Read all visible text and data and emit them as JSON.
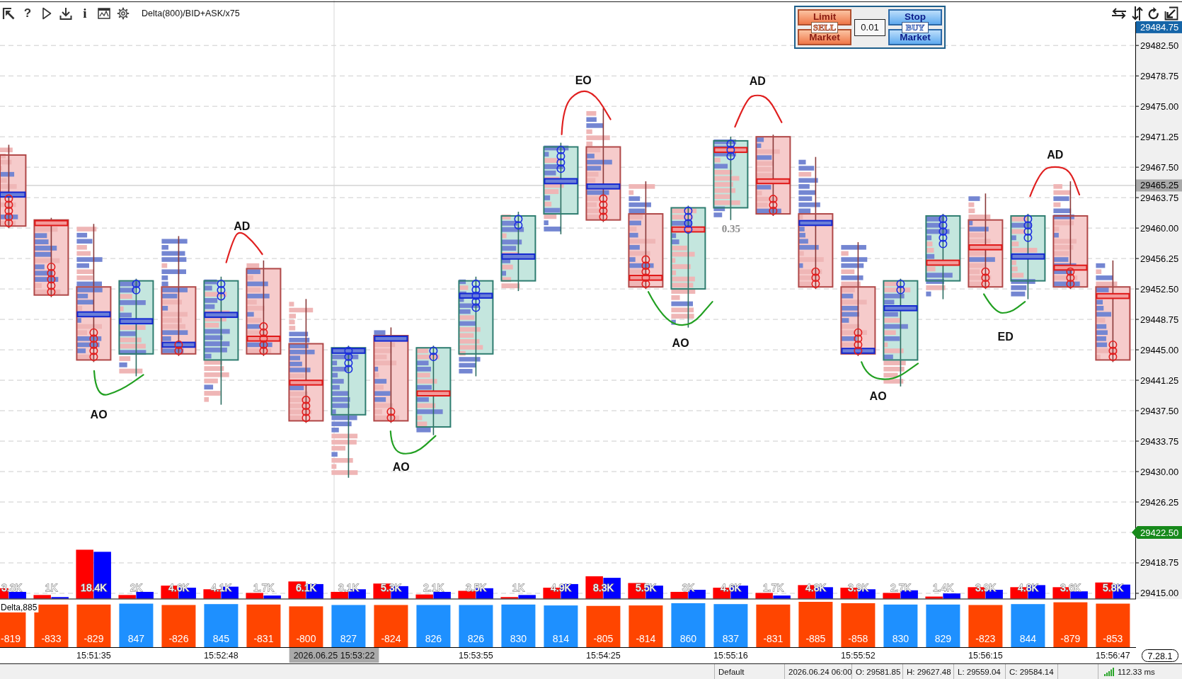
{
  "toolbar": {
    "help_glyph": "?",
    "info_glyph": "i",
    "study": "Delta(800)/BID+ASK/x75"
  },
  "order_panel": {
    "sell_buttons": [
      "Limit",
      "Market"
    ],
    "sell_tag": "SELL",
    "quantity": "0.01",
    "buy_buttons": [
      "Stop",
      "Market"
    ],
    "buy_tag": "BUY"
  },
  "chart": {
    "price_axis": {
      "labels": [
        "29482.50",
        "29478.75",
        "29475.00",
        "29471.25",
        "29467.50",
        "29463.75",
        "29460.00",
        "29456.25",
        "29452.50",
        "29448.75",
        "29445.00",
        "29441.25",
        "29437.50",
        "29433.75",
        "29430.00",
        "29426.25",
        "29418.75",
        "29415.00"
      ],
      "markers": [
        {
          "kind": "tag",
          "label": "29484.75",
          "color": "#1565a8"
        },
        {
          "kind": "level",
          "label": "29465.25",
          "color": "#a9a9a9"
        },
        {
          "kind": "pointer",
          "label": "29422.50",
          "color": "#17891b"
        }
      ]
    },
    "annotations": [
      {
        "kind": "note",
        "text": "AO",
        "color": "#22a022"
      },
      {
        "kind": "note",
        "text": "AD",
        "color": "#e02020"
      },
      {
        "kind": "note",
        "text": "AO",
        "color": "#22a022"
      },
      {
        "kind": "note",
        "text": "EO",
        "color": "#e02020"
      },
      {
        "kind": "note",
        "text": "AO",
        "color": "#22a022"
      },
      {
        "kind": "value",
        "text": "0.35"
      },
      {
        "kind": "note",
        "text": "AD",
        "color": "#e02020"
      },
      {
        "kind": "note",
        "text": "AO",
        "color": "#22a022"
      },
      {
        "kind": "note",
        "text": "ED",
        "color": "#22a022"
      },
      {
        "kind": "note",
        "text": "AD",
        "color": "#e02020"
      }
    ],
    "volume": [
      {
        "label": "3.3K",
        "bars": [
          {
            "color": "#ff0000",
            "level": 0.2
          },
          {
            "color": "#0000ff",
            "level": 0.13
          }
        ]
      },
      {
        "label": "1K",
        "bars": [
          {
            "color": "#ff0000",
            "level": 0.07
          },
          {
            "color": "#0000ff",
            "level": 0.03
          }
        ]
      },
      {
        "label": "18.4K",
        "bars": [
          {
            "color": "#ff0000",
            "level": 0.94
          },
          {
            "color": "#0000ff",
            "level": 0.9
          }
        ]
      },
      {
        "label": "2K",
        "bars": [
          {
            "color": "#ff0000",
            "level": 0.07
          },
          {
            "color": "#0000ff",
            "level": 0.13
          }
        ]
      },
      {
        "label": "4.6K",
        "bars": [
          {
            "color": "#ff0000",
            "level": 0.25
          },
          {
            "color": "#0000ff",
            "level": 0.21
          }
        ]
      },
      {
        "label": "4.1K",
        "bars": [
          {
            "color": "#ff0000",
            "level": 0.18
          },
          {
            "color": "#0000ff",
            "level": 0.23
          }
        ]
      },
      {
        "label": "1.7K",
        "bars": [
          {
            "color": "#ff0000",
            "level": 0.11
          },
          {
            "color": "#0000ff",
            "level": 0.06
          }
        ]
      },
      {
        "label": "6.1K",
        "bars": [
          {
            "color": "#ff0000",
            "level": 0.33
          },
          {
            "color": "#0000ff",
            "level": 0.28
          }
        ]
      },
      {
        "label": "3.1K",
        "bars": [
          {
            "color": "#ff0000",
            "level": 0.13
          },
          {
            "color": "#0000ff",
            "level": 0.18
          }
        ]
      },
      {
        "label": "5.3K",
        "bars": [
          {
            "color": "#ff0000",
            "level": 0.29
          },
          {
            "color": "#0000ff",
            "level": 0.24
          }
        ]
      },
      {
        "label": "2.1K",
        "bars": [
          {
            "color": "#ff0000",
            "level": 0.08
          },
          {
            "color": "#0000ff",
            "level": 0.13
          }
        ]
      },
      {
        "label": "3.5K",
        "bars": [
          {
            "color": "#ff0000",
            "level": 0.15
          },
          {
            "color": "#0000ff",
            "level": 0.2
          }
        ]
      },
      {
        "label": "1K",
        "bars": [
          {
            "color": "#ff0000",
            "level": 0.03
          },
          {
            "color": "#0000ff",
            "level": 0.07
          }
        ]
      },
      {
        "label": "4.9K",
        "bars": [
          {
            "color": "#ff0000",
            "level": 0.21
          },
          {
            "color": "#0000ff",
            "level": 0.28
          }
        ]
      },
      {
        "label": "8.3K",
        "bars": [
          {
            "color": "#ff0000",
            "level": 0.43
          },
          {
            "color": "#0000ff",
            "level": 0.4
          }
        ]
      },
      {
        "label": "5.5K",
        "bars": [
          {
            "color": "#ff0000",
            "level": 0.3
          },
          {
            "color": "#0000ff",
            "level": 0.25
          }
        ]
      },
      {
        "label": "3K",
        "bars": [
          {
            "color": "#ff0000",
            "level": 0.13
          },
          {
            "color": "#0000ff",
            "level": 0.17
          }
        ]
      },
      {
        "label": "4.6K",
        "bars": [
          {
            "color": "#ff0000",
            "level": 0.21
          },
          {
            "color": "#0000ff",
            "level": 0.25
          }
        ]
      },
      {
        "label": "1.7K",
        "bars": [
          {
            "color": "#ff0000",
            "level": 0.11
          },
          {
            "color": "#0000ff",
            "level": 0.06
          }
        ]
      },
      {
        "label": "4.8K",
        "bars": [
          {
            "color": "#ff0000",
            "level": 0.26
          },
          {
            "color": "#0000ff",
            "level": 0.22
          }
        ]
      },
      {
        "label": "3.9K",
        "bars": [
          {
            "color": "#ff0000",
            "level": 0.21
          },
          {
            "color": "#0000ff",
            "level": 0.18
          }
        ]
      },
      {
        "label": "2.7K",
        "bars": [
          {
            "color": "#ff0000",
            "level": 0.11
          },
          {
            "color": "#0000ff",
            "level": 0.16
          }
        ]
      },
      {
        "label": "1.4K",
        "bars": [
          {
            "color": "#ff0000",
            "level": 0.04
          },
          {
            "color": "#0000ff",
            "level": 0.1
          }
        ]
      },
      {
        "label": "3.9K",
        "bars": [
          {
            "color": "#ff0000",
            "level": 0.22
          },
          {
            "color": "#0000ff",
            "level": 0.17
          }
        ]
      },
      {
        "label": "4.8K",
        "bars": [
          {
            "color": "#ff0000",
            "level": 0.22
          },
          {
            "color": "#0000ff",
            "level": 0.26
          }
        ]
      },
      {
        "label": "3.6K",
        "bars": [
          {
            "color": "#ff0000",
            "level": 0.22
          },
          {
            "color": "#0000ff",
            "level": 0.14
          }
        ]
      },
      {
        "label": "5.8K",
        "bars": [
          {
            "color": "#ff0000",
            "level": 0.31
          },
          {
            "color": "#0000ff",
            "level": 0.27
          }
        ]
      }
    ],
    "delta": {
      "title": "Delta,885",
      "bars": [
        {
          "value": "-819",
          "color": "#ff4500",
          "level": 0.93
        },
        {
          "value": "-833",
          "color": "#ff4500",
          "level": 0.94
        },
        {
          "value": "-829",
          "color": "#ff4500",
          "level": 0.94
        },
        {
          "value": "847",
          "color": "#1e90ff",
          "level": 0.96
        },
        {
          "value": "-826",
          "color": "#ff4500",
          "level": 0.93
        },
        {
          "value": "845",
          "color": "#1e90ff",
          "level": 0.95
        },
        {
          "value": "-831",
          "color": "#ff4500",
          "level": 0.94
        },
        {
          "value": "-800",
          "color": "#ff4500",
          "level": 0.9
        },
        {
          "value": "827",
          "color": "#1e90ff",
          "level": 0.93
        },
        {
          "value": "-824",
          "color": "#ff4500",
          "level": 0.93
        },
        {
          "value": "826",
          "color": "#1e90ff",
          "level": 0.93
        },
        {
          "value": "826",
          "color": "#1e90ff",
          "level": 0.93
        },
        {
          "value": "830",
          "color": "#1e90ff",
          "level": 0.94
        },
        {
          "value": "814",
          "color": "#1e90ff",
          "level": 0.92
        },
        {
          "value": "-805",
          "color": "#ff4500",
          "level": 0.91
        },
        {
          "value": "-814",
          "color": "#ff4500",
          "level": 0.92
        },
        {
          "value": "860",
          "color": "#1e90ff",
          "level": 0.97
        },
        {
          "value": "837",
          "color": "#1e90ff",
          "level": 0.95
        },
        {
          "value": "-831",
          "color": "#ff4500",
          "level": 0.94
        },
        {
          "value": "-885",
          "color": "#ff4500",
          "level": 1.0
        },
        {
          "value": "-858",
          "color": "#ff4500",
          "level": 0.97
        },
        {
          "value": "830",
          "color": "#1e90ff",
          "level": 0.94
        },
        {
          "value": "829",
          "color": "#1e90ff",
          "level": 0.94
        },
        {
          "value": "-823",
          "color": "#ff4500",
          "level": 0.93
        },
        {
          "value": "844",
          "color": "#1e90ff",
          "level": 0.95
        },
        {
          "value": "-879",
          "color": "#ff4500",
          "level": 0.99
        },
        {
          "value": "-853",
          "color": "#ff4500",
          "level": 0.96
        }
      ]
    },
    "time_axis": {
      "labels": [
        "15:51:35",
        "15:52:48",
        "15:53:55",
        "15:54:25",
        "15:55:16",
        "15:55:52",
        "15:56:15",
        "15:56:47"
      ],
      "cursor_label": "2026.06.25 15:53:22"
    },
    "version": "7.28.1"
  },
  "status_bar": {
    "items": [
      "Default",
      "2026.06.24 06:00",
      "O: 29581.85",
      "H: 29627.48",
      "L: 29559.04",
      "C: 29584.14"
    ],
    "latency": "112.33 ms"
  }
}
